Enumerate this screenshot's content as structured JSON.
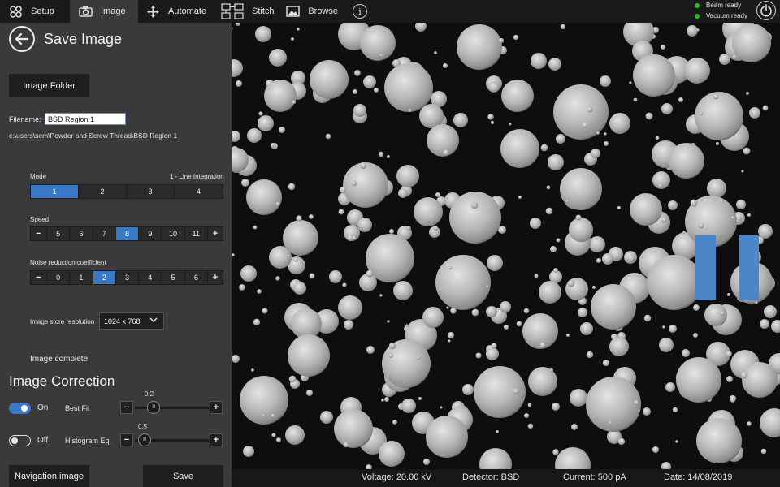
{
  "nav": {
    "tabs": [
      {
        "label": "Setup",
        "icon": "gear-cluster-icon"
      },
      {
        "label": "Image",
        "icon": "camera-icon"
      },
      {
        "label": "Automate",
        "icon": "move-arrows-icon"
      },
      {
        "label": "Stitch",
        "icon": "stitch-grid-icon"
      },
      {
        "label": "Browse",
        "icon": "picture-icon"
      }
    ],
    "active_tab": "Image",
    "info_glyph": "i"
  },
  "status": {
    "beam": "Beam ready",
    "vacuum": "Vacuum ready",
    "indicator_color": "#22c322"
  },
  "panel": {
    "title": "Save Image",
    "image_folder_button": "Image Folder",
    "filename_label": "Filename:",
    "filename_value": "BSD Region 1",
    "path": "c:\\users\\sem\\Powder and Screw Thread\\BSD Region 1",
    "mode": {
      "label": "Mode",
      "current": "1 - Line Integration",
      "options": [
        "1",
        "2",
        "3",
        "4"
      ],
      "selected": "1"
    },
    "speed": {
      "label": "Speed",
      "minus": "−",
      "plus": "+",
      "options": [
        "5",
        "6",
        "7",
        "8",
        "9",
        "10",
        "11"
      ],
      "selected": "8"
    },
    "noise": {
      "label": "Noise reduction coefficient",
      "minus": "−",
      "plus": "+",
      "options": [
        "0",
        "1",
        "2",
        "3",
        "4",
        "5",
        "6"
      ],
      "selected": "2"
    },
    "resolution": {
      "label": "Image store resolution",
      "value": "1024 x 768"
    },
    "status_text": "Image complete",
    "correction": {
      "title": "Image Correction",
      "best_fit": {
        "state": "On",
        "label": "Best Fit",
        "value": "0.2",
        "position": 0.2
      },
      "histogram": {
        "state": "Off",
        "label": "Histogram Eq.",
        "value": "0.5",
        "position": 0.05
      },
      "minus": "−",
      "plus": "+"
    },
    "navigation_button": "Navigation image",
    "save_button": "Save"
  },
  "footer": {
    "voltage": "Voltage: 20.00 kV",
    "detector": "Detector: BSD",
    "current": "Current: 500 pA",
    "date": "Date: 14/08/2019"
  },
  "accent_color": "#3a78c8"
}
